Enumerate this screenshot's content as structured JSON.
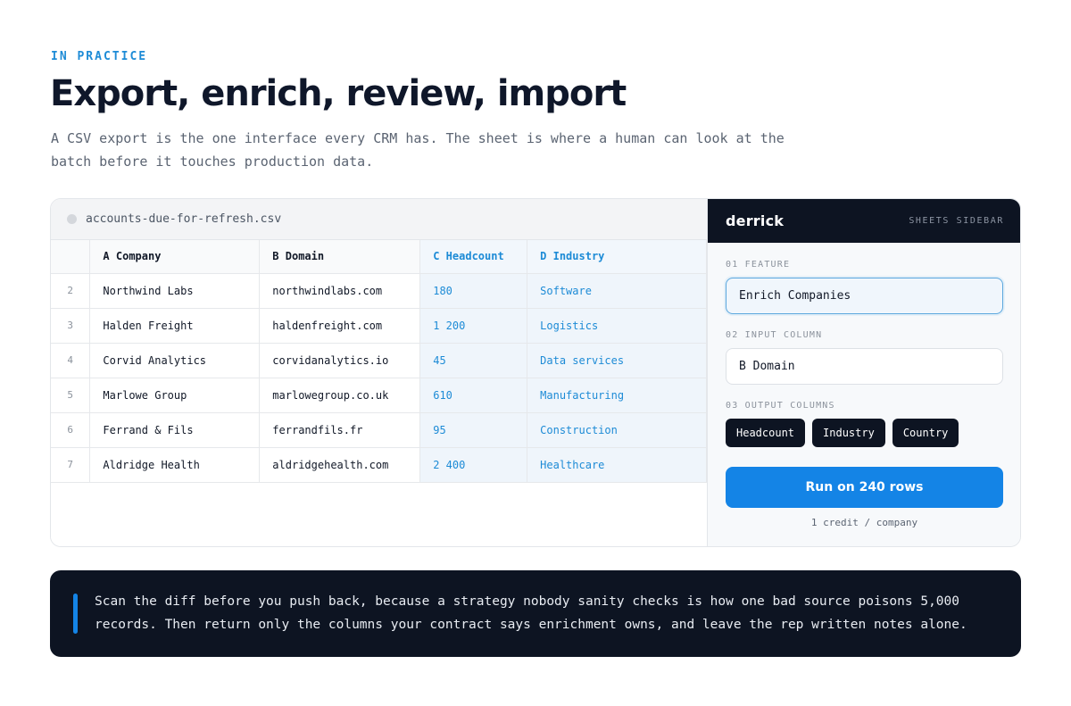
{
  "eyebrow": "IN PRACTICE",
  "headline": "Export, enrich, review, import",
  "lede": "A CSV export is the one interface every CRM has. The sheet is where a human can look at the batch before it touches production data.",
  "sheet": {
    "filename": "accounts-due-for-refresh.csv",
    "columns": [
      "A Company",
      "B Domain",
      "C Headcount",
      "D Industry"
    ],
    "rows": [
      {
        "num": "2",
        "company": "Northwind Labs",
        "domain": "northwindlabs.com",
        "headcount": "180",
        "industry": "Software"
      },
      {
        "num": "3",
        "company": "Halden Freight",
        "domain": "haldenfreight.com",
        "headcount": "1 200",
        "industry": "Logistics"
      },
      {
        "num": "4",
        "company": "Corvid Analytics",
        "domain": "corvidanalytics.io",
        "headcount": "45",
        "industry": "Data services"
      },
      {
        "num": "5",
        "company": "Marlowe Group",
        "domain": "marlowegroup.co.uk",
        "headcount": "610",
        "industry": "Manufacturing"
      },
      {
        "num": "6",
        "company": "Ferrand & Fils",
        "domain": "ferrandfils.fr",
        "headcount": "95",
        "industry": "Construction"
      },
      {
        "num": "7",
        "company": "Aldridge Health",
        "domain": "aldridgehealth.com",
        "headcount": "2 400",
        "industry": "Healthcare"
      }
    ]
  },
  "sidebar": {
    "brand": "derrick",
    "tag": "SHEETS SIDEBAR",
    "feature_label": "01 FEATURE",
    "feature_value": "Enrich Companies",
    "input_label": "02 INPUT COLUMN",
    "input_value": "B Domain",
    "output_label": "03 OUTPUT COLUMNS",
    "outputs": [
      "Headcount",
      "Industry",
      "Country"
    ],
    "run_label": "Run on 240 rows",
    "credit_note": "1 credit / company"
  },
  "callout": "Scan the diff before you push back, because a strategy nobody sanity checks is how one bad source poisons 5,000 records. Then return only the columns your contract says enrichment owns, and leave the rep written notes alone.",
  "colors": {
    "accent": "#1484e6",
    "dark": "#0d1422",
    "enriched_text": "#1d8bd6"
  }
}
